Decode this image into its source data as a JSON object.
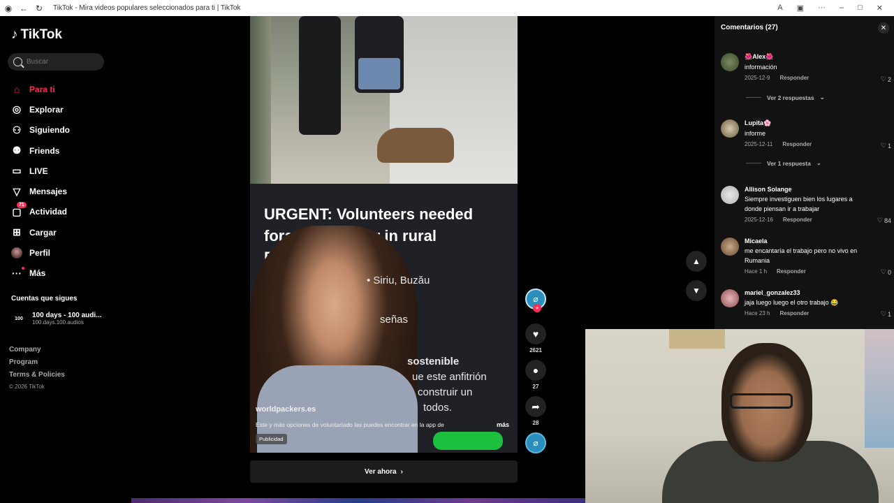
{
  "browser": {
    "title": "TikTok - Mira videos populares seleccionados para ti | TikTok"
  },
  "sidebar": {
    "logo": "TikTok",
    "search_placeholder": "Buscar",
    "items": [
      {
        "label": "Para ti",
        "icon": "home-icon",
        "active": true
      },
      {
        "label": "Explorar",
        "icon": "compass-icon"
      },
      {
        "label": "Siguiendo",
        "icon": "following-icon"
      },
      {
        "label": "Friends",
        "icon": "friends-icon"
      },
      {
        "label": "LIVE",
        "icon": "live-icon"
      },
      {
        "label": "Mensajes",
        "icon": "messages-icon"
      },
      {
        "label": "Actividad",
        "icon": "activity-icon",
        "badge": "71"
      },
      {
        "label": "Cargar",
        "icon": "upload-icon"
      },
      {
        "label": "Perfil",
        "icon": "avatar"
      },
      {
        "label": "Más",
        "icon": "more-icon"
      }
    ],
    "following_title": "Cuentas que sigues",
    "following_account": {
      "name": "100 days - 100 audi...",
      "handle": "100.days.100.audios",
      "avatar_text": "100"
    },
    "footer": [
      "Company",
      "Program",
      "Terms & Policies"
    ],
    "copyright": "© 2026 TikTok"
  },
  "video": {
    "headline": "URGENT: Volunteers needed fora dog shelter in rural ROMANIA NOW",
    "location": "• Siriu, Buzău",
    "line2": "señas",
    "line3": "sostenible",
    "line4": "ue este anfitrión",
    "line5": "construir un",
    "line6": "todos.",
    "brand": "worldpackers.es",
    "description": "Este y más opciones de voluntariado las puedes encontrar en la app de",
    "more": "más",
    "ad_label": "Publicidad",
    "cta": "Ver ahora"
  },
  "actions": {
    "likes": "2621",
    "comments": "27",
    "shares": "28"
  },
  "comments": {
    "header": "Comentarios",
    "count": "(27)",
    "items": [
      {
        "name": "🌺Alex🌺",
        "text": "información",
        "date": "2025-12-9",
        "reply": "Responder",
        "likes": "2",
        "replies": "Ver 2 respuestas"
      },
      {
        "name": "Lupita🌸",
        "text": "informe",
        "date": "2025-12-11",
        "reply": "Responder",
        "likes": "1",
        "replies": "Ver 1 respuesta"
      },
      {
        "name": "Allison Solange",
        "text": "Siempre investiguen bien los lugares a donde piensan ir a trabajar",
        "date": "2025-12-16",
        "reply": "Responder",
        "likes": "84"
      },
      {
        "name": "Micaela",
        "text": "me encantaría el trabajo pero no vivo en Rumania",
        "date": "Hace 1 h",
        "reply": "Responder",
        "likes": "0"
      },
      {
        "name": "mariel_gonzalez33",
        "text": "jaja luego luego el otro trabajo 😂",
        "date": "Hace 23 h",
        "reply": "Responder",
        "likes": "1"
      }
    ]
  },
  "colors": {
    "accent": "#fe2c55",
    "background": "#000000",
    "panel": "#121212"
  }
}
